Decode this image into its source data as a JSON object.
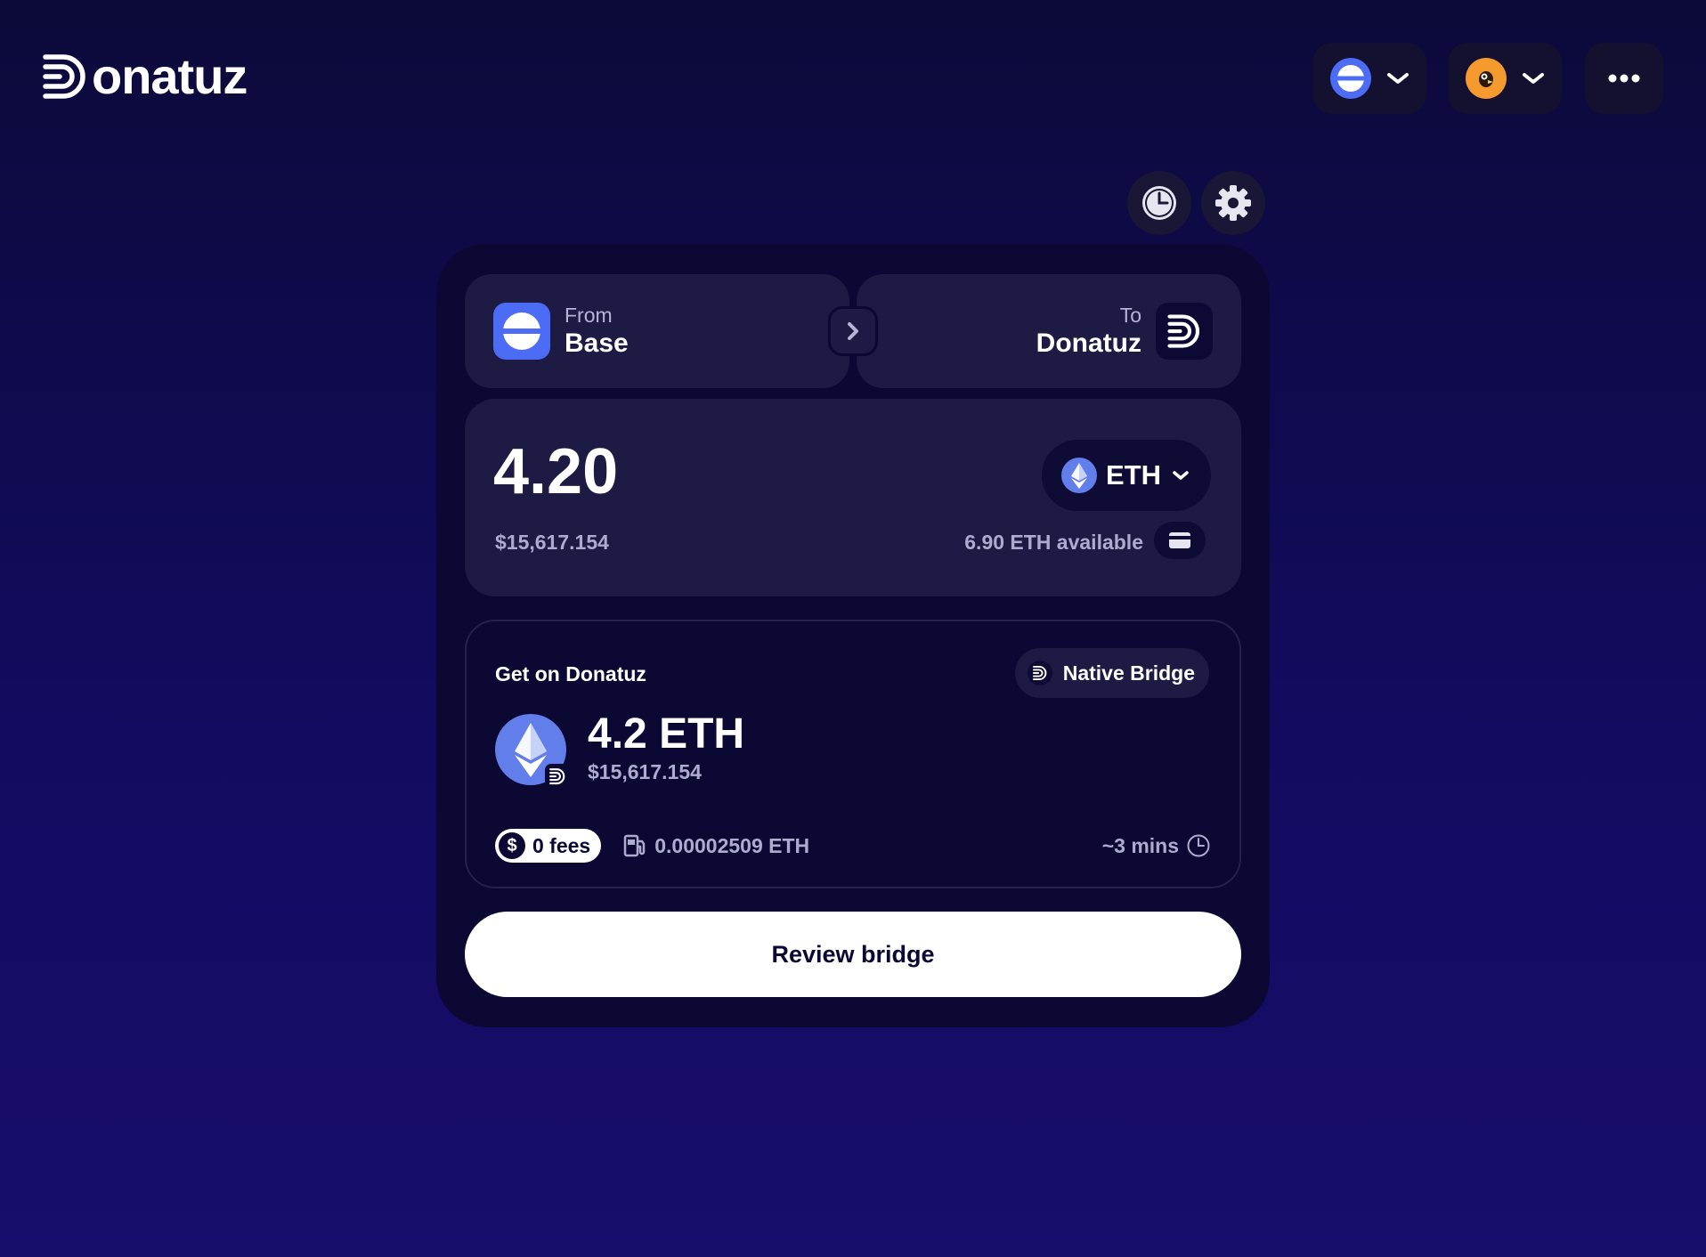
{
  "brand": {
    "name": "onatuz"
  },
  "header": {
    "network_selector": {
      "icon": "base-network-icon"
    },
    "account_selector": {
      "icon": "avatar"
    },
    "more_menu": {
      "icon": "more-icon"
    }
  },
  "toolbar": {
    "history_icon": "clock-icon",
    "settings_icon": "gear-icon"
  },
  "bridge": {
    "from": {
      "label": "From",
      "name": "Base"
    },
    "to": {
      "label": "To",
      "name": "Donatuz"
    },
    "amount": {
      "value": "4.20",
      "usd": "$15,617.154"
    },
    "token": {
      "symbol": "ETH"
    },
    "available": "6.90 ETH available"
  },
  "receive": {
    "title": "Get on Donatuz",
    "route": "Native Bridge",
    "amount": "4.2 ETH",
    "usd": "$15,617.154",
    "fees": "0 fees",
    "fee_symbol": "$",
    "gas": "0.00002509 ETH",
    "eta": "~3 mins"
  },
  "actions": {
    "review_label": "Review bridge"
  },
  "colors": {
    "background_top": "#0c0a3a",
    "background_bottom": "#170d6c",
    "card": "#0b0834",
    "panel": "#1d1a44",
    "base_blue": "#4c6cf5",
    "eth_purple": "#627eea",
    "avatar_orange": "#f59a2f"
  }
}
